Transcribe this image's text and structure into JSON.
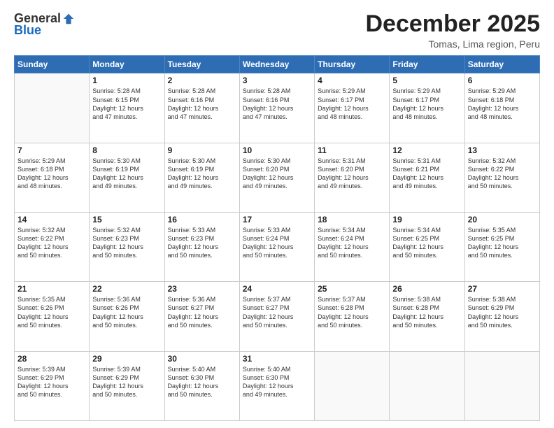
{
  "header": {
    "logo_general": "General",
    "logo_blue": "Blue",
    "month": "December 2025",
    "location": "Tomas, Lima region, Peru"
  },
  "days_of_week": [
    "Sunday",
    "Monday",
    "Tuesday",
    "Wednesday",
    "Thursday",
    "Friday",
    "Saturday"
  ],
  "weeks": [
    [
      {
        "day": "",
        "info": ""
      },
      {
        "day": "1",
        "info": "Sunrise: 5:28 AM\nSunset: 6:15 PM\nDaylight: 12 hours\nand 47 minutes."
      },
      {
        "day": "2",
        "info": "Sunrise: 5:28 AM\nSunset: 6:16 PM\nDaylight: 12 hours\nand 47 minutes."
      },
      {
        "day": "3",
        "info": "Sunrise: 5:28 AM\nSunset: 6:16 PM\nDaylight: 12 hours\nand 47 minutes."
      },
      {
        "day": "4",
        "info": "Sunrise: 5:29 AM\nSunset: 6:17 PM\nDaylight: 12 hours\nand 48 minutes."
      },
      {
        "day": "5",
        "info": "Sunrise: 5:29 AM\nSunset: 6:17 PM\nDaylight: 12 hours\nand 48 minutes."
      },
      {
        "day": "6",
        "info": "Sunrise: 5:29 AM\nSunset: 6:18 PM\nDaylight: 12 hours\nand 48 minutes."
      }
    ],
    [
      {
        "day": "7",
        "info": "Sunrise: 5:29 AM\nSunset: 6:18 PM\nDaylight: 12 hours\nand 48 minutes."
      },
      {
        "day": "8",
        "info": "Sunrise: 5:30 AM\nSunset: 6:19 PM\nDaylight: 12 hours\nand 49 minutes."
      },
      {
        "day": "9",
        "info": "Sunrise: 5:30 AM\nSunset: 6:19 PM\nDaylight: 12 hours\nand 49 minutes."
      },
      {
        "day": "10",
        "info": "Sunrise: 5:30 AM\nSunset: 6:20 PM\nDaylight: 12 hours\nand 49 minutes."
      },
      {
        "day": "11",
        "info": "Sunrise: 5:31 AM\nSunset: 6:20 PM\nDaylight: 12 hours\nand 49 minutes."
      },
      {
        "day": "12",
        "info": "Sunrise: 5:31 AM\nSunset: 6:21 PM\nDaylight: 12 hours\nand 49 minutes."
      },
      {
        "day": "13",
        "info": "Sunrise: 5:32 AM\nSunset: 6:22 PM\nDaylight: 12 hours\nand 50 minutes."
      }
    ],
    [
      {
        "day": "14",
        "info": "Sunrise: 5:32 AM\nSunset: 6:22 PM\nDaylight: 12 hours\nand 50 minutes."
      },
      {
        "day": "15",
        "info": "Sunrise: 5:32 AM\nSunset: 6:23 PM\nDaylight: 12 hours\nand 50 minutes."
      },
      {
        "day": "16",
        "info": "Sunrise: 5:33 AM\nSunset: 6:23 PM\nDaylight: 12 hours\nand 50 minutes."
      },
      {
        "day": "17",
        "info": "Sunrise: 5:33 AM\nSunset: 6:24 PM\nDaylight: 12 hours\nand 50 minutes."
      },
      {
        "day": "18",
        "info": "Sunrise: 5:34 AM\nSunset: 6:24 PM\nDaylight: 12 hours\nand 50 minutes."
      },
      {
        "day": "19",
        "info": "Sunrise: 5:34 AM\nSunset: 6:25 PM\nDaylight: 12 hours\nand 50 minutes."
      },
      {
        "day": "20",
        "info": "Sunrise: 5:35 AM\nSunset: 6:25 PM\nDaylight: 12 hours\nand 50 minutes."
      }
    ],
    [
      {
        "day": "21",
        "info": "Sunrise: 5:35 AM\nSunset: 6:26 PM\nDaylight: 12 hours\nand 50 minutes."
      },
      {
        "day": "22",
        "info": "Sunrise: 5:36 AM\nSunset: 6:26 PM\nDaylight: 12 hours\nand 50 minutes."
      },
      {
        "day": "23",
        "info": "Sunrise: 5:36 AM\nSunset: 6:27 PM\nDaylight: 12 hours\nand 50 minutes."
      },
      {
        "day": "24",
        "info": "Sunrise: 5:37 AM\nSunset: 6:27 PM\nDaylight: 12 hours\nand 50 minutes."
      },
      {
        "day": "25",
        "info": "Sunrise: 5:37 AM\nSunset: 6:28 PM\nDaylight: 12 hours\nand 50 minutes."
      },
      {
        "day": "26",
        "info": "Sunrise: 5:38 AM\nSunset: 6:28 PM\nDaylight: 12 hours\nand 50 minutes."
      },
      {
        "day": "27",
        "info": "Sunrise: 5:38 AM\nSunset: 6:29 PM\nDaylight: 12 hours\nand 50 minutes."
      }
    ],
    [
      {
        "day": "28",
        "info": "Sunrise: 5:39 AM\nSunset: 6:29 PM\nDaylight: 12 hours\nand 50 minutes."
      },
      {
        "day": "29",
        "info": "Sunrise: 5:39 AM\nSunset: 6:29 PM\nDaylight: 12 hours\nand 50 minutes."
      },
      {
        "day": "30",
        "info": "Sunrise: 5:40 AM\nSunset: 6:30 PM\nDaylight: 12 hours\nand 50 minutes."
      },
      {
        "day": "31",
        "info": "Sunrise: 5:40 AM\nSunset: 6:30 PM\nDaylight: 12 hours\nand 49 minutes."
      },
      {
        "day": "",
        "info": ""
      },
      {
        "day": "",
        "info": ""
      },
      {
        "day": "",
        "info": ""
      }
    ]
  ]
}
